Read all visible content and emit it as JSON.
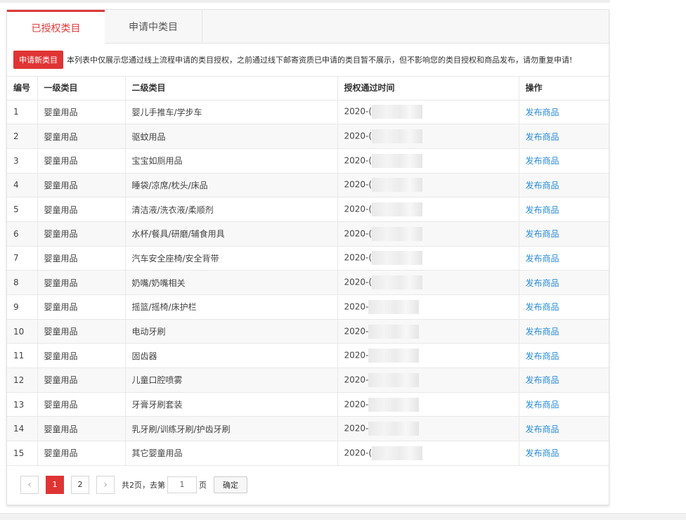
{
  "tabs": [
    {
      "label": "已授权类目",
      "active": true
    },
    {
      "label": "申请中类目",
      "active": false
    }
  ],
  "notice": {
    "apply_button": "申请新类目",
    "text": "本列表中仅展示您通过线上流程申请的类目授权，之前通过线下邮寄资质已申请的类目暂不展示，但不影响您的类目授权和商品发布，请勿重复申请!"
  },
  "table": {
    "headers": [
      "编号",
      "一级类目",
      "二级类目",
      "授权通过时间",
      "操作"
    ],
    "rows": [
      {
        "no": "1",
        "level1": "婴童用品",
        "level2": "婴儿手推车/学步车",
        "time": "2020-(",
        "action": "发布商品"
      },
      {
        "no": "2",
        "level1": "婴童用品",
        "level2": "驱蚊用品",
        "time": "2020-(",
        "action": "发布商品"
      },
      {
        "no": "3",
        "level1": "婴童用品",
        "level2": "宝宝如厕用品",
        "time": "2020-(",
        "action": "发布商品"
      },
      {
        "no": "4",
        "level1": "婴童用品",
        "level2": "睡袋/凉席/枕头/床品",
        "time": "2020-(",
        "action": "发布商品"
      },
      {
        "no": "5",
        "level1": "婴童用品",
        "level2": "清洁液/洗衣液/柔顺剂",
        "time": "2020-(",
        "action": "发布商品"
      },
      {
        "no": "6",
        "level1": "婴童用品",
        "level2": "水杯/餐具/研磨/辅食用具",
        "time": "2020-(",
        "action": "发布商品"
      },
      {
        "no": "7",
        "level1": "婴童用品",
        "level2": "汽车安全座椅/安全背带",
        "time": "2020-(",
        "action": "发布商品"
      },
      {
        "no": "8",
        "level1": "婴童用品",
        "level2": "奶嘴/奶嘴相关",
        "time": "2020-(",
        "action": "发布商品"
      },
      {
        "no": "9",
        "level1": "婴童用品",
        "level2": "摇篮/摇椅/床护栏",
        "time": "2020-",
        "action": "发布商品"
      },
      {
        "no": "10",
        "level1": "婴童用品",
        "level2": "电动牙刷",
        "time": "2020-",
        "action": "发布商品"
      },
      {
        "no": "11",
        "level1": "婴童用品",
        "level2": "固齿器",
        "time": "2020-",
        "action": "发布商品"
      },
      {
        "no": "12",
        "level1": "婴童用品",
        "level2": "儿童口腔喷雾",
        "time": "2020-",
        "action": "发布商品"
      },
      {
        "no": "13",
        "level1": "婴童用品",
        "level2": "牙膏牙刷套装",
        "time": "2020-",
        "action": "发布商品"
      },
      {
        "no": "14",
        "level1": "婴童用品",
        "level2": "乳牙刷/训练牙刷/护齿牙刷",
        "time": "2020-",
        "action": "发布商品"
      },
      {
        "no": "15",
        "level1": "婴童用品",
        "level2": "其它婴童用品",
        "time": "2020-(",
        "action": "发布商品"
      }
    ]
  },
  "pagination": {
    "prev_icon": "‹",
    "next_icon": "›",
    "pages": [
      "1",
      "2"
    ],
    "current": "1",
    "total_text": "共2页，去第",
    "goto_value": "1",
    "page_suffix": "页",
    "confirm_label": "确定"
  },
  "colors": {
    "accent": "#e03434",
    "link": "#2a8bd6"
  }
}
